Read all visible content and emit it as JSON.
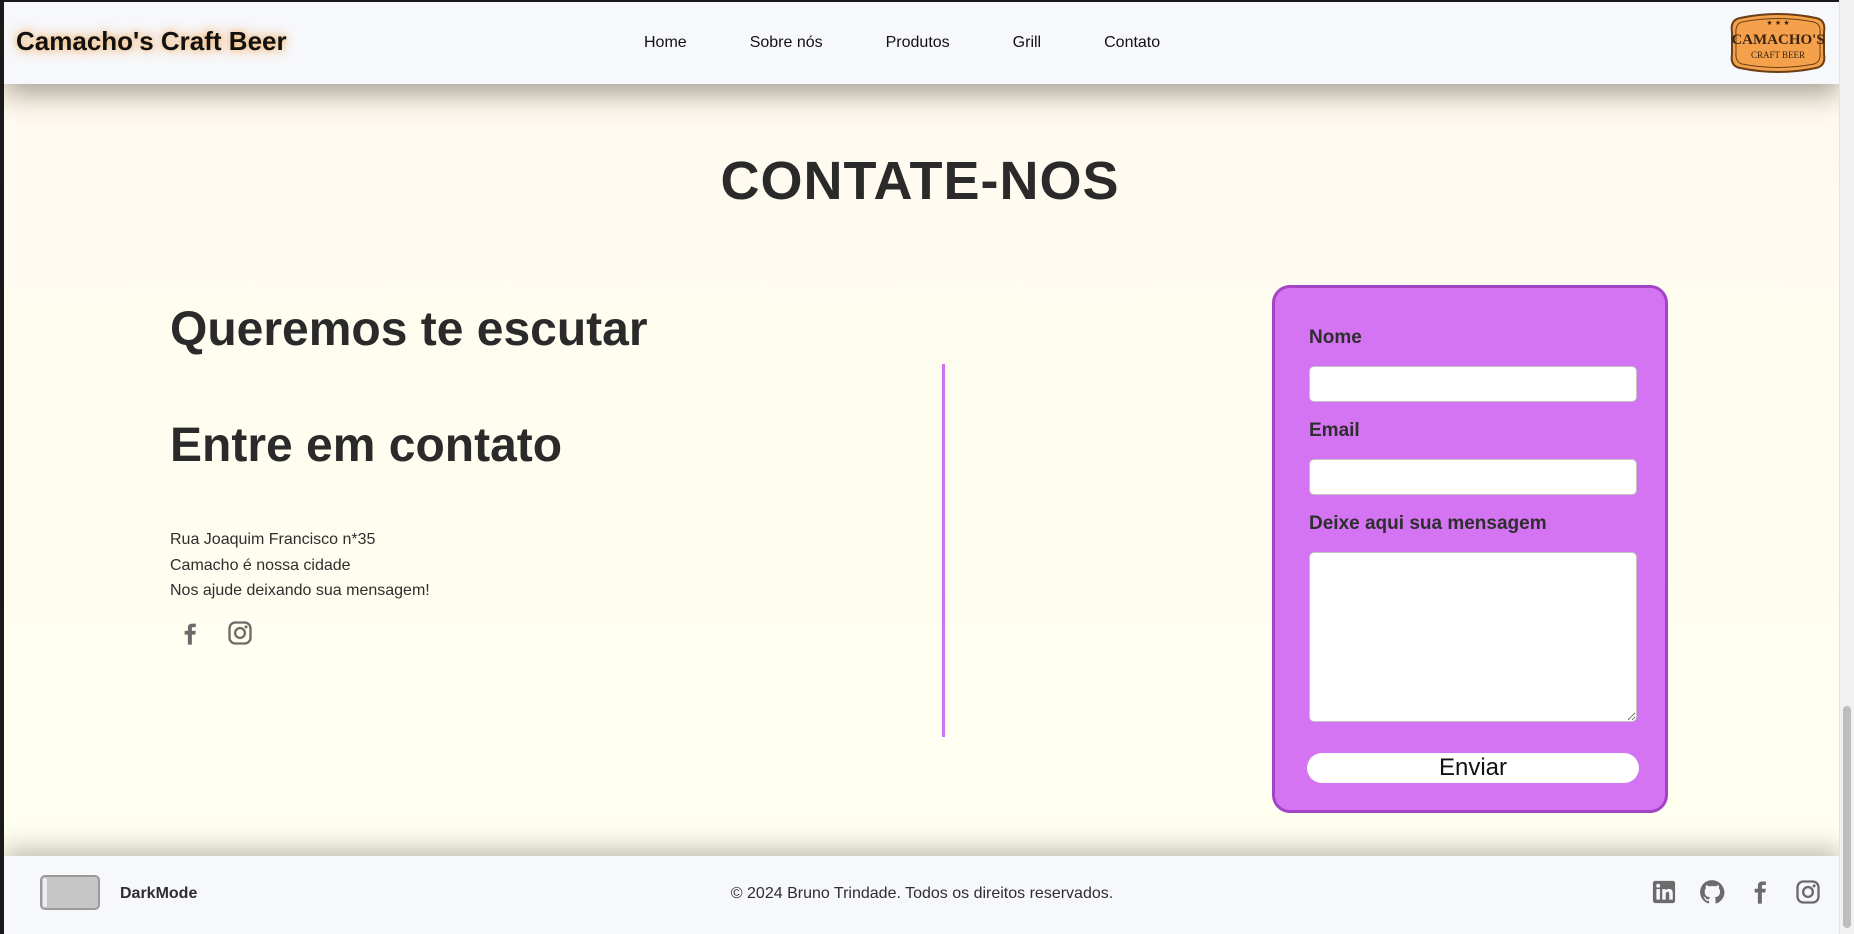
{
  "header": {
    "brand": "Camacho's Craft Beer",
    "nav": [
      "Home",
      "Sobre nós",
      "Produtos",
      "Grill",
      "Contato"
    ],
    "logo_text": {
      "line1": "CAMACHO'S",
      "line2": "CRAFT BEER"
    }
  },
  "main": {
    "title": "CONTATE-NOS",
    "heading_listen": "Queremos te escutar",
    "heading_contact": "Entre em contato",
    "info": [
      "Rua Joaquim Francisco n*35",
      "Camacho é nossa cidade",
      "Nos ajude deixando sua mensagem!"
    ],
    "social_icons": [
      "facebook-icon",
      "instagram-icon"
    ]
  },
  "form": {
    "name_label": "Nome",
    "name_value": "",
    "email_label": "Email",
    "email_value": "",
    "message_label": "Deixe aqui sua mensagem",
    "message_value": "",
    "submit_label": "Enviar"
  },
  "footer": {
    "darkmode_label": "DarkMode",
    "darkmode_on": false,
    "copyright": "© 2024 Bruno Trindade. Todos os direitos reservados.",
    "icons": [
      "linkedin-icon",
      "github-icon",
      "facebook-icon",
      "instagram-icon"
    ]
  },
  "colors": {
    "page_bg": "#fffdf4",
    "bars_bg": "#f7f8fc",
    "form_bg": "#d474f3",
    "form_border": "#a244c4",
    "divider": "#d070ee",
    "text": "#2e2e2e",
    "icon_gray": "#6b6b6b",
    "logo_orange": "#f5a04a"
  }
}
